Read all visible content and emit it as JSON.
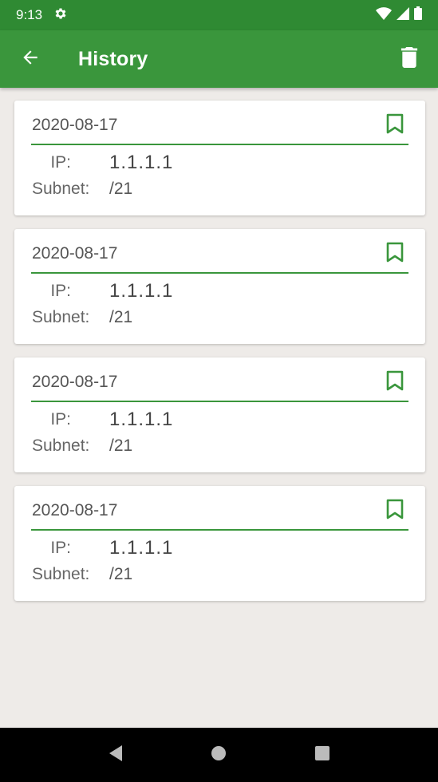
{
  "status_bar": {
    "time": "9:13",
    "icons": [
      "gear-icon",
      "wifi-icon",
      "signal-icon",
      "battery-icon"
    ]
  },
  "app_bar": {
    "title": "History",
    "back_icon": "arrow-left-icon",
    "delete_icon": "trash-icon",
    "color": "#3a963c"
  },
  "history": {
    "items": [
      {
        "date": "2020-08-17",
        "ip_label": "IP:",
        "ip": "1.1.1.1",
        "subnet_label": "Subnet:",
        "subnet": "/21"
      },
      {
        "date": "2020-08-17",
        "ip_label": "IP:",
        "ip": "1.1.1.1",
        "subnet_label": "Subnet:",
        "subnet": "/21"
      },
      {
        "date": "2020-08-17",
        "ip_label": "IP:",
        "ip": "1.1.1.1",
        "subnet_label": "Subnet:",
        "subnet": "/21"
      },
      {
        "date": "2020-08-17",
        "ip_label": "IP:",
        "ip": "1.1.1.1",
        "subnet_label": "Subnet:",
        "subnet": "/21"
      }
    ]
  },
  "nav_bar": {
    "icons": [
      "back-triangle-icon",
      "home-circle-icon",
      "recents-square-icon"
    ]
  }
}
